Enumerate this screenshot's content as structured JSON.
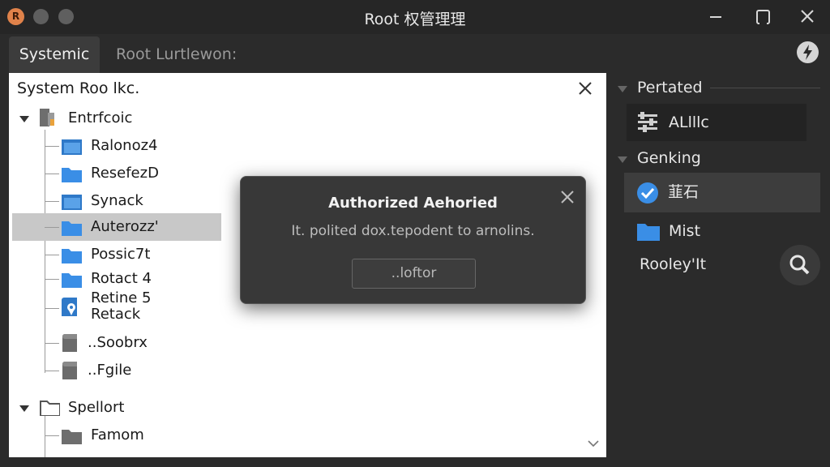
{
  "window": {
    "title": "Root 权管理理",
    "app_icon_letter": "R"
  },
  "tabs": [
    {
      "label": "Systemic"
    },
    {
      "label": "Root Lurtlewon:"
    }
  ],
  "tree_panel": {
    "title": "System Roo lkc.",
    "items": [
      {
        "label": "Entrfcoic"
      },
      {
        "label": "Ralonoz4"
      },
      {
        "label": "ResefezD"
      },
      {
        "label": "Synack"
      },
      {
        "label": "Auterozz'"
      },
      {
        "label": "Possic7t"
      },
      {
        "label": "Rotact 4"
      },
      {
        "label": "Retine 5"
      },
      {
        "label": "Retack"
      },
      {
        "label": "..Soobrx"
      },
      {
        "label": "..Fgile"
      },
      {
        "label": "Spellort"
      },
      {
        "label": "Famom"
      }
    ]
  },
  "right_panel": {
    "section1": {
      "label": "Pertated",
      "items": [
        {
          "label": "ALlllc"
        }
      ]
    },
    "section2": {
      "label": "Genking",
      "items": [
        {
          "label": "韮石"
        },
        {
          "label": "Mist"
        },
        {
          "label": "Rooley'It"
        }
      ]
    }
  },
  "modal": {
    "title": "Authorized Aehoried",
    "message": "It. polited dox.tepodent to arnolins.",
    "button_label": "..loftor"
  },
  "colors": {
    "accent_blue": "#3a8ee6",
    "app_icon_orange": "#e0824a",
    "selected_row": "#c8c8c8"
  }
}
